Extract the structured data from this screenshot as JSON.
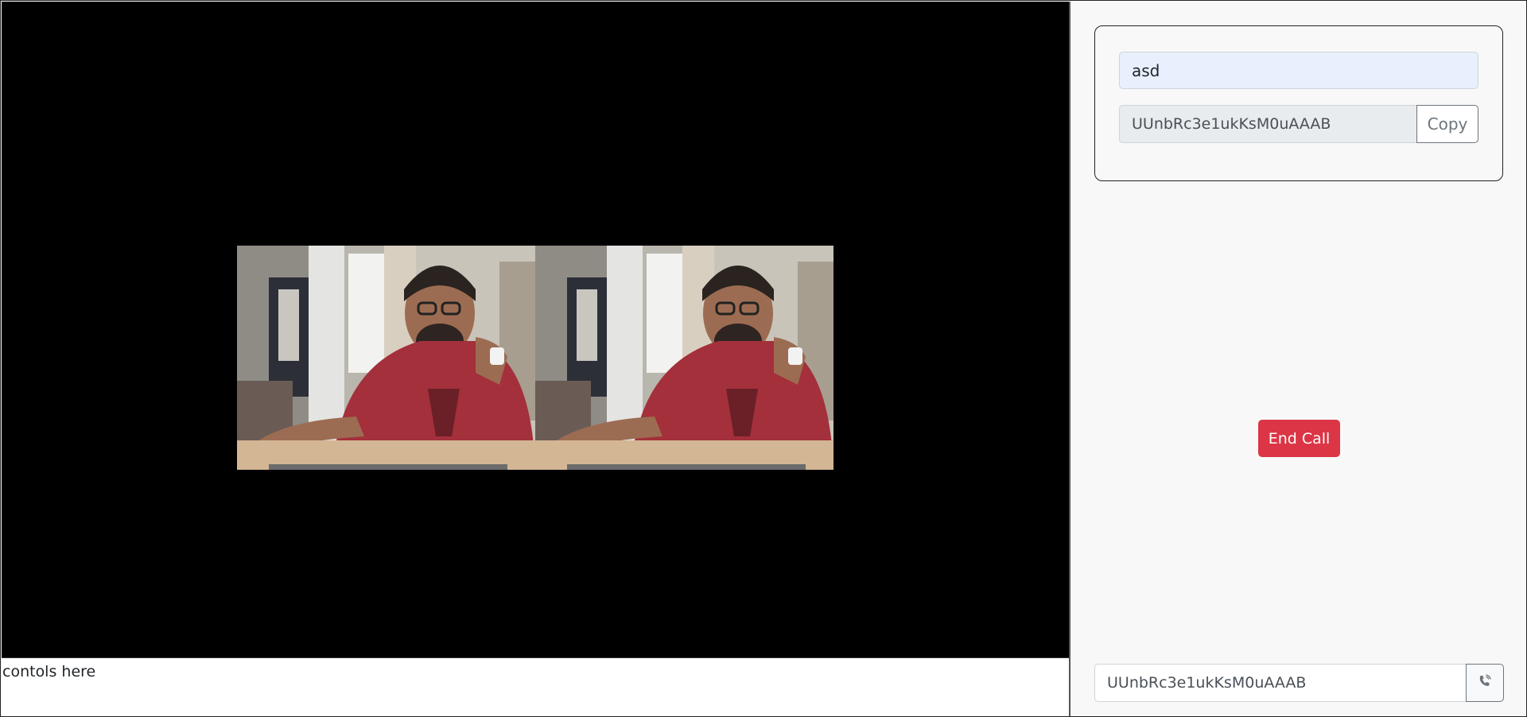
{
  "video": {
    "tiles": [
      {
        "label": "local-video"
      },
      {
        "label": "remote-video"
      }
    ]
  },
  "controls": {
    "text": "contols here"
  },
  "room": {
    "name_value": "asd",
    "id_value": "UUnbRc3e1ukKsM0uAAAB",
    "copy_label": "Copy"
  },
  "call": {
    "end_label": "End Call",
    "peer_id_value": "UUnbRc3e1ukKsM0uAAAB",
    "call_icon": "phone-ringing-icon"
  },
  "colors": {
    "danger": "#dc3545",
    "stage_bg": "#000000",
    "panel_bg": "#f8f8f8",
    "autofill_bg": "#e8f0fe"
  }
}
